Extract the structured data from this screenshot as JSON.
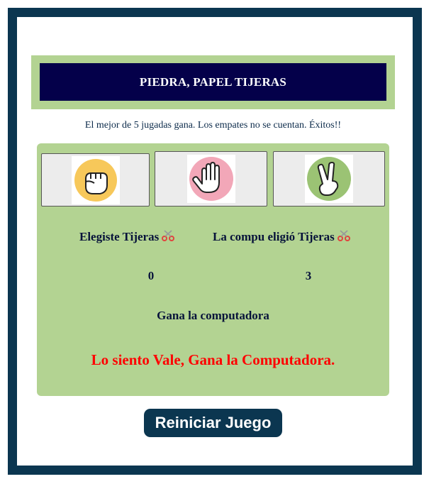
{
  "header": {
    "title": "PIEDRA, PAPEL TIJERAS"
  },
  "instructions": "El mejor de 5 jugadas gana. Los empates no se cuentan. Éxitos!!",
  "choices": [
    {
      "name": "piedra",
      "icon": "rock-hand-icon",
      "circle_color": "#f7c85a"
    },
    {
      "name": "papel",
      "icon": "paper-hand-icon",
      "circle_color": "#f2a7b8"
    },
    {
      "name": "tijeras",
      "icon": "scissors-hand-icon",
      "circle_color": "#9bc374"
    }
  ],
  "result": {
    "player_choice": "Elegiste Tijeras",
    "cpu_choice": "La compu eligió Tijeras",
    "player_score": "0",
    "cpu_score": "3",
    "round_result": "Gana la computadora",
    "final_message": "Lo siento Vale, Gana la Computadora."
  },
  "buttons": {
    "restart_label": "Reiniciar Juego"
  },
  "colors": {
    "frame": "#0b3650",
    "panel": "#b3d392",
    "title_bg": "#04004a",
    "final_message": "#ff0000"
  }
}
